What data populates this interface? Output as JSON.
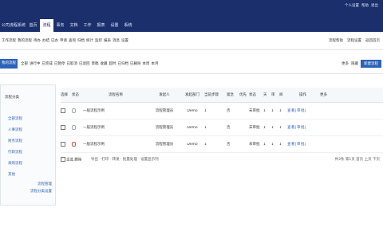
{
  "header": {
    "brand": "公司流程系统",
    "tabs": [
      "首页",
      "流程",
      "事务",
      "文档",
      "工作",
      "报表",
      "设置",
      "系统"
    ],
    "active_tab_index": 1,
    "top_links": [
      "个人设置",
      "帮助",
      "退出"
    ]
  },
  "menubar": {
    "items": [
      "工作流程",
      "我的流程",
      "待办",
      "办结",
      "已办",
      "申请",
      "查询",
      "归档",
      "统计",
      "监控",
      "报表",
      "消息",
      "设置"
    ],
    "right_items": [
      "流程帮助",
      "流程设置",
      "返回首页"
    ]
  },
  "subbar": {
    "tag": "我的流程",
    "chips": [
      "全部",
      "进行中",
      "已完成",
      "已暂停",
      "已取消",
      "已退回",
      "草稿",
      "收藏",
      "超时",
      "已归档",
      "已删除",
      "本周",
      "本月"
    ],
    "right_text": [
      "更多",
      "隐藏"
    ],
    "primary_button": "新建流程"
  },
  "sidebar": {
    "title": "流程分类",
    "items": [
      "全部流程",
      "人事流程",
      "财务流程",
      "行政流程",
      "采购流程",
      "其他"
    ],
    "footer": [
      "流程管理",
      "流程分类设置"
    ]
  },
  "table": {
    "headers": [
      "选择",
      "状态",
      "流程名称",
      "发起人",
      "发起部门",
      "当前步骤",
      "紧急",
      "优先",
      "状态",
      "天",
      "审",
      "阅",
      "操作",
      "更多"
    ],
    "rows": [
      {
        "name": "一般流程示例",
        "user": "流程管理员",
        "dept": "Demo",
        "step": "1",
        "urgent": "否",
        "status": "未审批",
        "d": "1",
        "a": "1",
        "r": "1",
        "pin": "grey"
      },
      {
        "name": "一般流程示例",
        "user": "流程管理员",
        "dept": "Demo",
        "step": "1",
        "urgent": "否",
        "status": "未审批",
        "d": "1",
        "a": "1",
        "r": "1",
        "pin": "grey"
      },
      {
        "name": "一般流程示例",
        "user": "流程管理员",
        "dept": "Demo",
        "step": "1",
        "urgent": "否",
        "status": "未审批",
        "d": "1",
        "a": "1",
        "r": "1",
        "pin": "red"
      }
    ],
    "row_actions": "查看|审批|删",
    "footer_left": "全选 删除",
    "footer_links": "导出 · 打印 · 转发 · 批量处理 · 设置显示列",
    "pager": "共3条 第1页 首页 上页 下页"
  },
  "colors": {
    "header_bg": "#1a2f6b",
    "accent": "#2b63b8"
  }
}
